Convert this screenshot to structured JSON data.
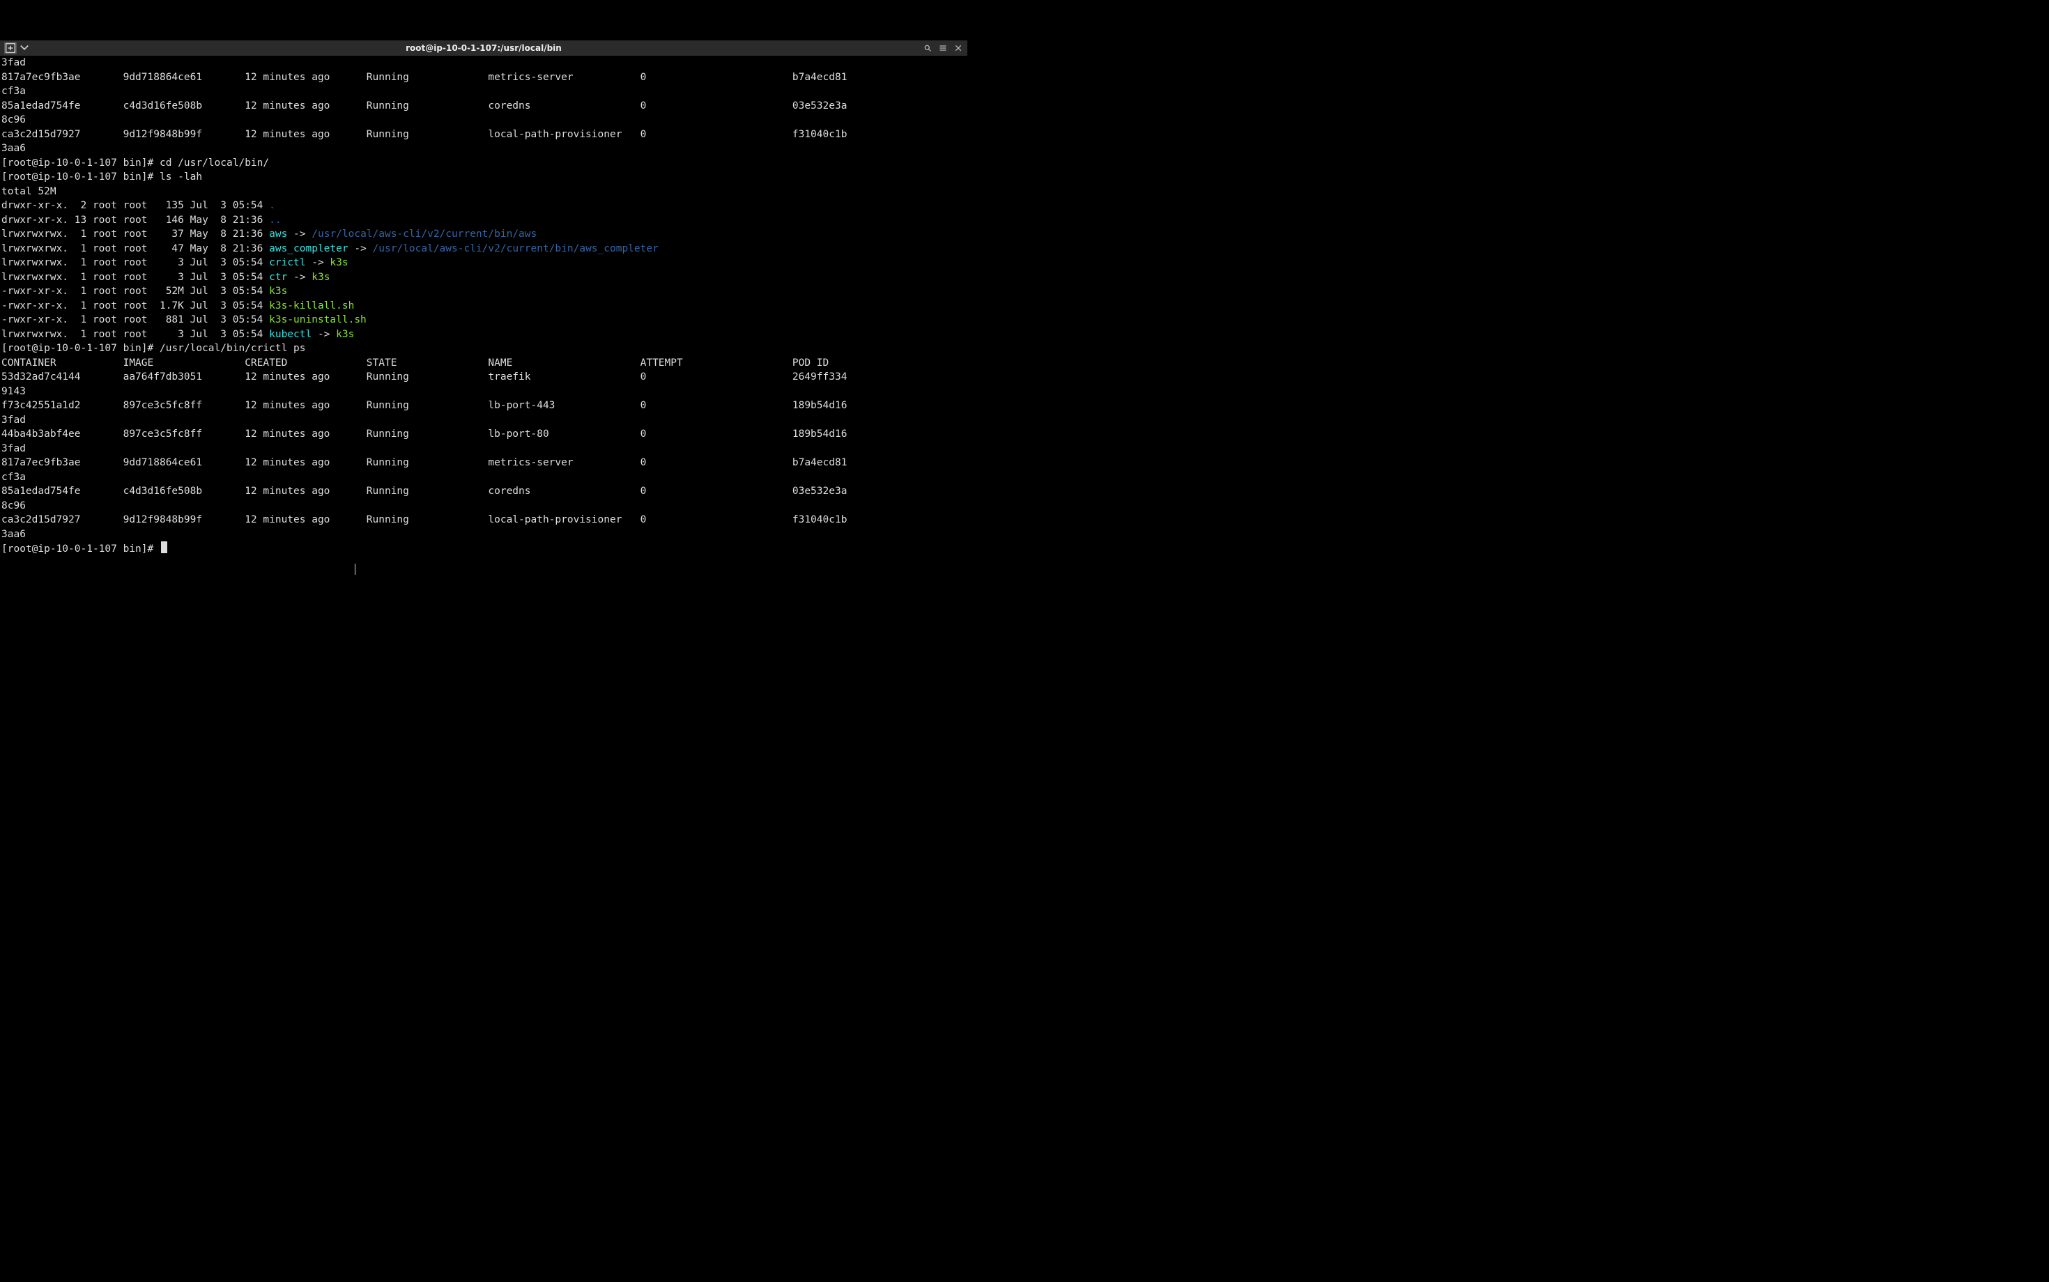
{
  "window": {
    "title": "root@ip-10-0-1-107:/usr/local/bin"
  },
  "prompt": {
    "user": "root",
    "host": "ip-10-0-1-107",
    "cwd_short": "bin",
    "text": "[root@ip-10-0-1-107 bin]# "
  },
  "colors": {
    "terminal_bg": "#000000",
    "terminal_fg": "#dddddd",
    "symlink": "#34e2e2",
    "directory": "#3465a4",
    "executable": "#8ae234",
    "titlebar_bg": "#2b2b2b"
  },
  "scrollback": {
    "orphan_wrap_rows": [
      "3fad",
      {
        "container": "817a7ec9fb3ae",
        "image": "9dd718864ce61",
        "created": "12 minutes ago",
        "state": "Running",
        "name": "metrics-server",
        "attempt": "0",
        "pod": "b7a4ecd81"
      },
      "cf3a",
      {
        "container": "85a1edad754fe",
        "image": "c4d3d16fe508b",
        "created": "12 minutes ago",
        "state": "Running",
        "name": "coredns",
        "attempt": "0",
        "pod": "03e532e3a"
      },
      "8c96",
      {
        "container": "ca3c2d15d7927",
        "image": "9d12f9848b99f",
        "created": "12 minutes ago",
        "state": "Running",
        "name": "local-path-provisioner",
        "attempt": "0",
        "pod": "f31040c1b"
      },
      "3aa6"
    ]
  },
  "commands": [
    {
      "cmd": "cd /usr/local/bin/"
    },
    {
      "cmd": "ls -lah"
    },
    {
      "cmd": "/usr/local/bin/crictl ps"
    }
  ],
  "ls": {
    "total": "total 52M",
    "entries": [
      {
        "perm": "drwxr-xr-x.",
        "links": "2",
        "user": "root",
        "group": "root",
        "size": "135",
        "date": "Jul  3 05:54",
        "name": ".",
        "type": "dir"
      },
      {
        "perm": "drwxr-xr-x.",
        "links": "13",
        "user": "root",
        "group": "root",
        "size": "146",
        "date": "May  8 21:36",
        "name": "..",
        "type": "dir"
      },
      {
        "perm": "lrwxrwxrwx.",
        "links": "1",
        "user": "root",
        "group": "root",
        "size": "37",
        "date": "May  8 21:36",
        "name": "aws",
        "type": "symlink",
        "target": "/usr/local/aws-cli/v2/current/bin/aws"
      },
      {
        "perm": "lrwxrwxrwx.",
        "links": "1",
        "user": "root",
        "group": "root",
        "size": "47",
        "date": "May  8 21:36",
        "name": "aws_completer",
        "type": "symlink",
        "target": "/usr/local/aws-cli/v2/current/bin/aws_completer"
      },
      {
        "perm": "lrwxrwxrwx.",
        "links": "1",
        "user": "root",
        "group": "root",
        "size": "3",
        "date": "Jul  3 05:54",
        "name": "crictl",
        "type": "symlink",
        "target": "k3s",
        "target_type": "exec"
      },
      {
        "perm": "lrwxrwxrwx.",
        "links": "1",
        "user": "root",
        "group": "root",
        "size": "3",
        "date": "Jul  3 05:54",
        "name": "ctr",
        "type": "symlink",
        "target": "k3s",
        "target_type": "exec"
      },
      {
        "perm": "-rwxr-xr-x.",
        "links": "1",
        "user": "root",
        "group": "root",
        "size": "52M",
        "date": "Jul  3 05:54",
        "name": "k3s",
        "type": "exec"
      },
      {
        "perm": "-rwxr-xr-x.",
        "links": "1",
        "user": "root",
        "group": "root",
        "size": "1.7K",
        "date": "Jul  3 05:54",
        "name": "k3s-killall.sh",
        "type": "exec"
      },
      {
        "perm": "-rwxr-xr-x.",
        "links": "1",
        "user": "root",
        "group": "root",
        "size": "881",
        "date": "Jul  3 05:54",
        "name": "k3s-uninstall.sh",
        "type": "exec"
      },
      {
        "perm": "lrwxrwxrwx.",
        "links": "1",
        "user": "root",
        "group": "root",
        "size": "3",
        "date": "Jul  3 05:54",
        "name": "kubectl",
        "type": "symlink",
        "target": "k3s",
        "target_type": "exec"
      }
    ]
  },
  "crictl": {
    "headers": [
      "CONTAINER",
      "IMAGE",
      "CREATED",
      "STATE",
      "NAME",
      "ATTEMPT",
      "POD ID"
    ],
    "rows": [
      {
        "container": "53d32ad7c4144",
        "image": "aa764f7db3051",
        "created": "12 minutes ago",
        "state": "Running",
        "name": "traefik",
        "attempt": "0",
        "pod": "2649ff334",
        "wrap": "9143"
      },
      {
        "container": "f73c42551a1d2",
        "image": "897ce3c5fc8ff",
        "created": "12 minutes ago",
        "state": "Running",
        "name": "lb-port-443",
        "attempt": "0",
        "pod": "189b54d16",
        "wrap": "3fad"
      },
      {
        "container": "44ba4b3abf4ee",
        "image": "897ce3c5fc8ff",
        "created": "12 minutes ago",
        "state": "Running",
        "name": "lb-port-80",
        "attempt": "0",
        "pod": "189b54d16",
        "wrap": "3fad"
      },
      {
        "container": "817a7ec9fb3ae",
        "image": "9dd718864ce61",
        "created": "12 minutes ago",
        "state": "Running",
        "name": "metrics-server",
        "attempt": "0",
        "pod": "b7a4ecd81",
        "wrap": "cf3a"
      },
      {
        "container": "85a1edad754fe",
        "image": "c4d3d16fe508b",
        "created": "12 minutes ago",
        "state": "Running",
        "name": "coredns",
        "attempt": "0",
        "pod": "03e532e3a",
        "wrap": "8c96"
      },
      {
        "container": "ca3c2d15d7927",
        "image": "9d12f9848b99f",
        "created": "12 minutes ago",
        "state": "Running",
        "name": "local-path-provisioner",
        "attempt": "0",
        "pod": "f31040c1b",
        "wrap": "3aa6"
      }
    ]
  }
}
